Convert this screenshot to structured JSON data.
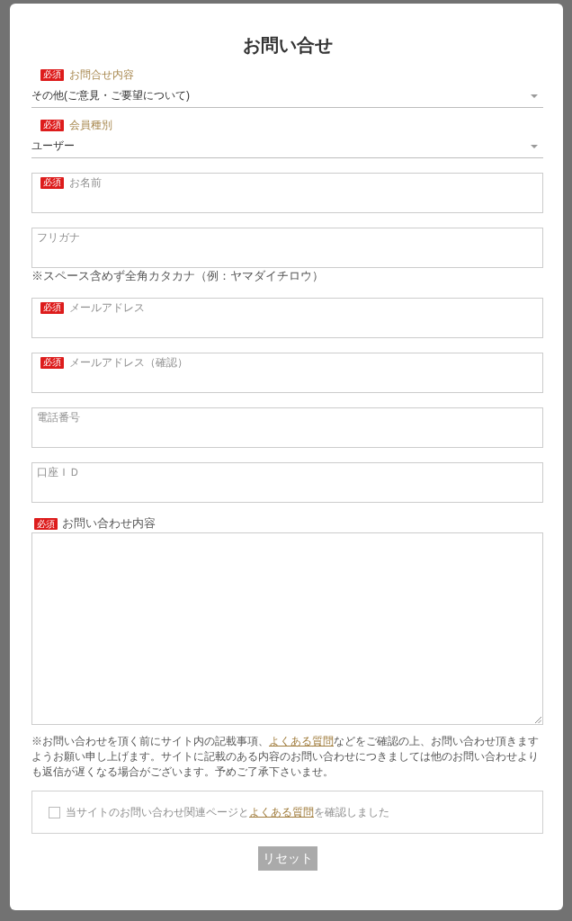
{
  "dialog": {
    "title": "お問い合せ"
  },
  "fields": [
    {
      "kind": "select",
      "badge": "必須",
      "label": "お問合せ内容",
      "value": "その他(ご意見・ご要望について)"
    },
    {
      "kind": "select",
      "badge": "必須",
      "label": "会員種別",
      "value": "ユーザー"
    },
    {
      "kind": "input",
      "badge": "必須",
      "label": "お名前"
    },
    {
      "kind": "input",
      "label": "フリガナ",
      "help": "※スペース含めず全角カタカナ（例：ヤマダイチロウ）"
    },
    {
      "kind": "input",
      "badge": "必須",
      "label": "メールアドレス"
    },
    {
      "kind": "input",
      "badge": "必須",
      "label": "メールアドレス（確認）"
    },
    {
      "kind": "input",
      "label": "電話番号"
    },
    {
      "kind": "input",
      "label": "口座ＩＤ"
    },
    {
      "kind": "textarea",
      "badge": "必須",
      "label": "お問い合わせ内容"
    }
  ],
  "notice": {
    "before": "※お問い合わせを頂く前にサイト内の記載事項、",
    "link": "よくある質問",
    "after": "などをご確認の上、お問い合わせ頂きますようお願い申し上げます。サイトに記載のある内容のお問い合わせにつきましては他のお問い合わせよりも返信が遅くなる場合がございます。予めご了承下さいませ。"
  },
  "agreement": {
    "checked": false,
    "before": "当サイトのお問い合わせ関連ページと",
    "link": "よくある質問",
    "after": "を確認しました"
  },
  "reset_button": {
    "label": "リセット",
    "disabled": true
  }
}
